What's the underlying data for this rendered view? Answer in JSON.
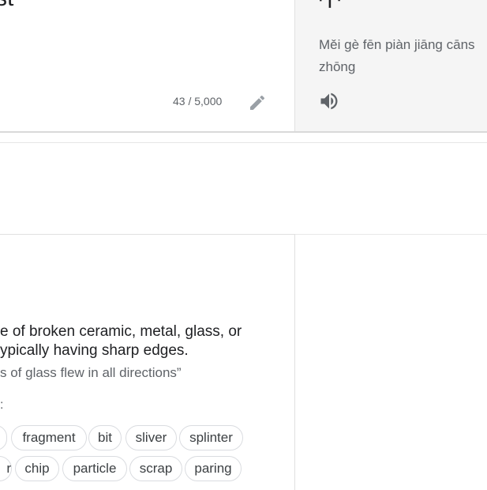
{
  "source": {
    "text_fragment": "st",
    "char_count": "43 / 5,000"
  },
  "target": {
    "text_fragment": "中",
    "romanization_line1": "Měi gè fēn piàn jiāng cāns",
    "romanization_line2": "zhōng"
  },
  "dictionary": {
    "definition_line1": "e of broken ceramic, metal, glass, or",
    "definition_line2": "ypically having sharp edges.",
    "example": "s of glass flew in all directions”",
    "synonyms_label": ":",
    "synonyms_row1": [
      "",
      "fragment",
      "bit",
      "sliver",
      "splinter"
    ],
    "synonyms_row2": [
      "r",
      "chip",
      "particle",
      "scrap",
      "paring"
    ]
  },
  "icons": {
    "edit": "pencil-icon",
    "speaker": "speaker-icon"
  }
}
